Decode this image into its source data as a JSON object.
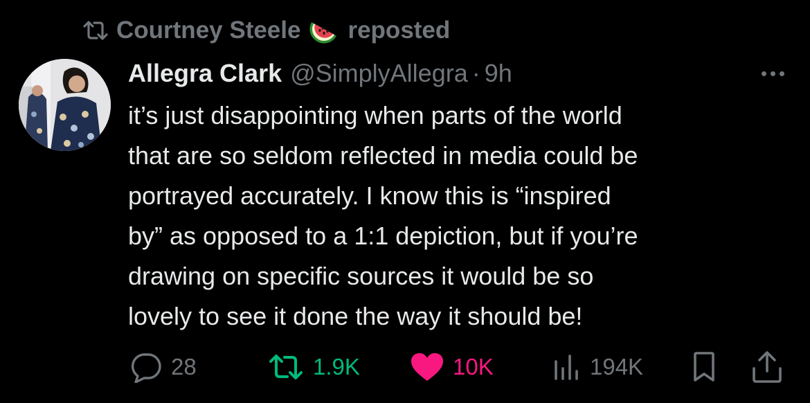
{
  "repost_banner": {
    "reposter_name": "Courtney Steele",
    "emoji_icon": "watermelon-icon",
    "suffix": "reposted"
  },
  "tweet": {
    "author_name": "Allegra Clark",
    "author_handle": "@SimplyAllegra",
    "separator": "·",
    "timestamp": "9h",
    "body_lines": [
      "it’s just disappointing when parts of the world",
      "that are so seldom reflected in media could be",
      "portrayed accurately. I know this is “inspired",
      "by” as opposed to a 1:1 depiction, but if you’re",
      "drawing on specific sources it would be so",
      "lovely to see it done the way it should be!"
    ]
  },
  "actions": {
    "replies": "28",
    "reposts": "1.9K",
    "likes": "10K",
    "views": "194K"
  },
  "colors": {
    "background": "#000000",
    "text_primary": "#e7e9ea",
    "text_secondary": "#71767b",
    "repost_active": "#00ba7c",
    "like_active": "#f91880"
  }
}
